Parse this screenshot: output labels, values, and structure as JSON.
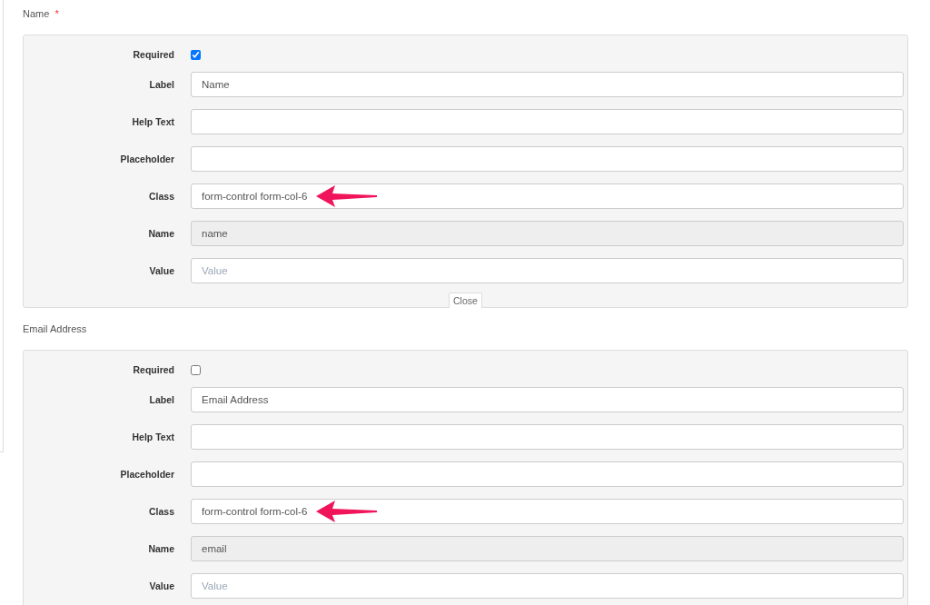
{
  "sections": [
    {
      "title": "Name",
      "required_mark": "*",
      "close_label": "Close",
      "fields": [
        {
          "kind": "checkbox",
          "label": "Required",
          "checked": true
        },
        {
          "kind": "text",
          "label": "Label",
          "value": "Name",
          "arrow": false
        },
        {
          "kind": "text",
          "label": "Help Text",
          "arrow": false
        },
        {
          "kind": "text",
          "label": "Placeholder",
          "arrow": false
        },
        {
          "kind": "text",
          "label": "Class",
          "value": "form-control form-col-6",
          "arrow": true
        },
        {
          "kind": "readonly",
          "label": "Name",
          "value": "name"
        },
        {
          "kind": "text",
          "label": "Value",
          "placeholder": "Value",
          "arrow": false
        }
      ]
    },
    {
      "title": "Email Address",
      "fields": [
        {
          "kind": "checkbox",
          "label": "Required",
          "checked": false
        },
        {
          "kind": "text",
          "label": "Label",
          "value": "Email Address",
          "arrow": false
        },
        {
          "kind": "text",
          "label": "Help Text",
          "arrow": false
        },
        {
          "kind": "text",
          "label": "Placeholder",
          "arrow": false
        },
        {
          "kind": "text",
          "label": "Class",
          "value": "form-control form-col-6",
          "arrow": true
        },
        {
          "kind": "readonly",
          "label": "Name",
          "value": "email"
        },
        {
          "kind": "text",
          "label": "Value",
          "placeholder": "Value",
          "arrow": false
        }
      ]
    }
  ]
}
